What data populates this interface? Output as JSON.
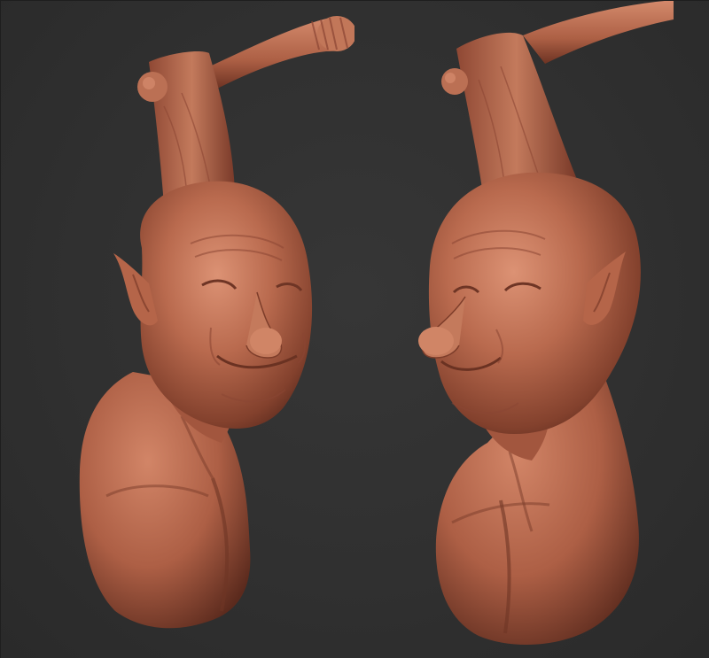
{
  "canvas": {
    "background_color": "#303030",
    "material_base_color": "#b96a4e",
    "material_highlight_color": "#d98f71",
    "material_shadow_color": "#6e3525"
  },
  "views": [
    {
      "name": "sculpt-front-three-quarter-view"
    },
    {
      "name": "sculpt-mirrored-three-quarter-view"
    }
  ]
}
